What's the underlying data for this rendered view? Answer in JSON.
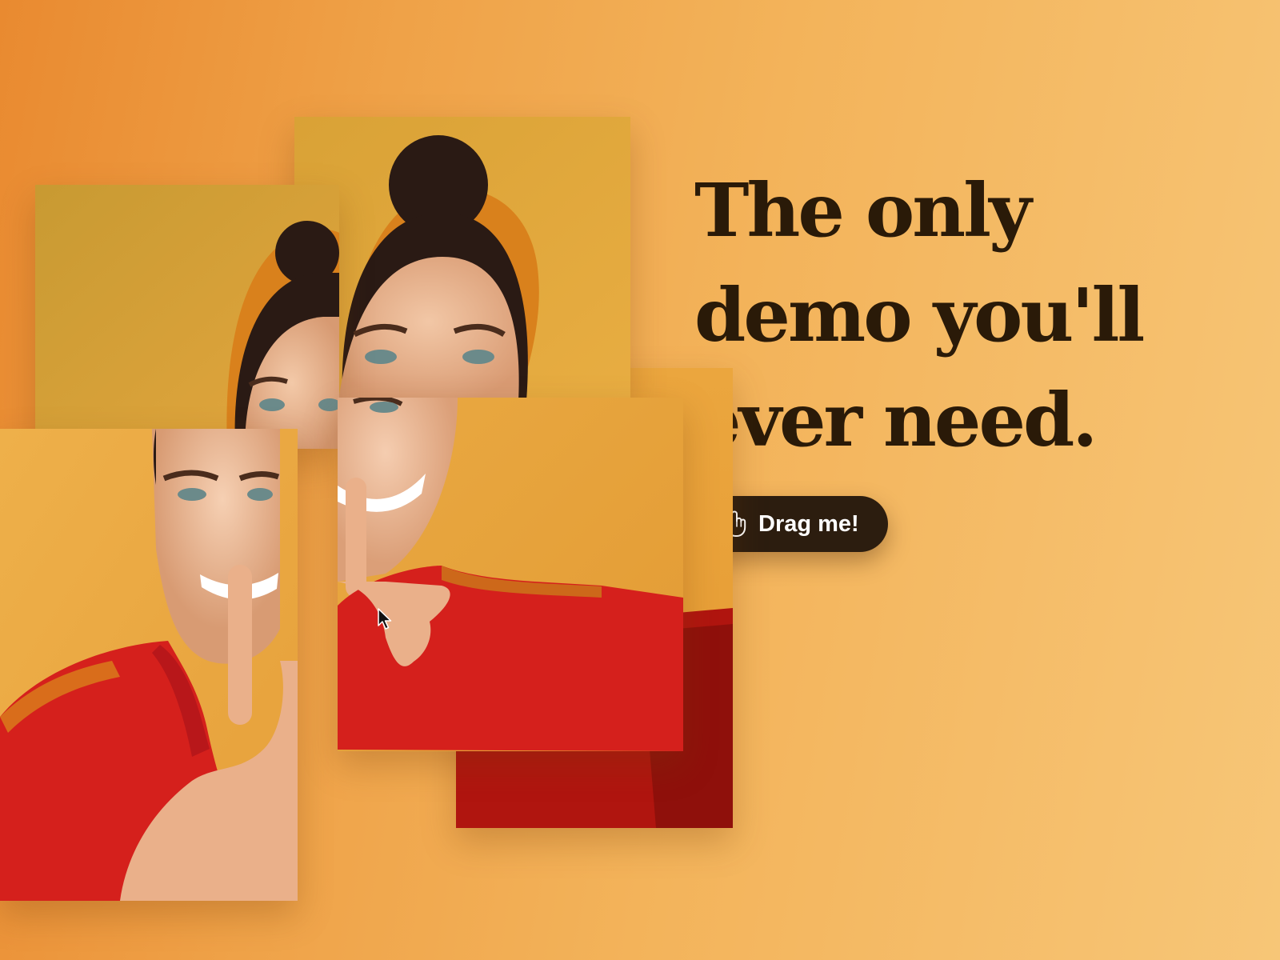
{
  "hero": {
    "headline_line1": "The only",
    "headline_line2": "demo you'll",
    "headline_line3": "ever need."
  },
  "cta": {
    "label": "Drag me!",
    "icon": "hand-pointer-icon"
  },
  "colors": {
    "background_start": "#e98a30",
    "background_end": "#f7c677",
    "headline": "#2a1a08",
    "button_bg": "#2c1d0f",
    "button_text": "#ffffff",
    "photo_backdrop": "#e6a93a",
    "sweater_red": "#d5201c"
  },
  "collage": {
    "tile_count": 5
  }
}
